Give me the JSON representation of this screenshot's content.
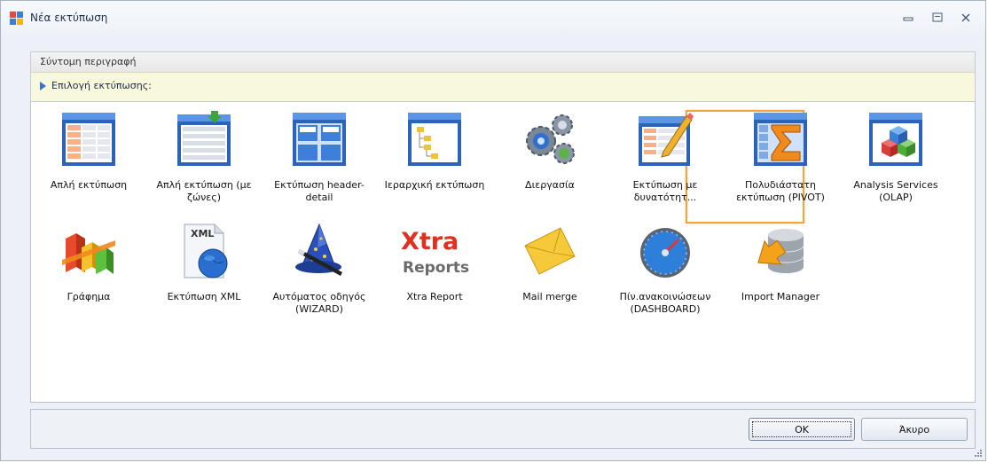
{
  "window": {
    "title": "Νέα εκτύπωση"
  },
  "description_panel": {
    "label": "Σύντομη περιγραφή"
  },
  "selection_panel": {
    "label": "Επιλογή εκτύπωσης:"
  },
  "items": [
    {
      "label": "Απλή εκτύπωση",
      "icon": "simple-report-icon"
    },
    {
      "label": "Απλή εκτύπωση (με ζώνες)",
      "icon": "banded-report-icon"
    },
    {
      "label": "Εκτύπωση header-detail",
      "icon": "header-detail-report-icon"
    },
    {
      "label": "Ιεραρχική εκτύπωση",
      "icon": "hierarchical-report-icon"
    },
    {
      "label": "Διεργασία",
      "icon": "gears-icon"
    },
    {
      "label": "Εκτύπωση με δυνατότητ...",
      "icon": "editable-report-icon"
    },
    {
      "label": "Πολυδιάστατη εκτύπωση (PIVOT)",
      "icon": "pivot-sigma-icon"
    },
    {
      "label": "Analysis Services (OLAP)",
      "icon": "olap-cubes-icon"
    },
    {
      "label": "Γράφημα",
      "icon": "bar-chart-icon"
    },
    {
      "label": "Εκτύπωση XML",
      "icon": "xml-globe-icon"
    },
    {
      "label": "Αυτόματος οδηγός (WIZARD)",
      "icon": "wizard-hat-icon"
    },
    {
      "label": "Xtra Report",
      "icon": "xtra-reports-logo"
    },
    {
      "label": "Mail merge",
      "icon": "envelope-icon"
    },
    {
      "label": "Πίν.ανακοινώσεων (DASHBOARD)",
      "icon": "dashboard-gauge-icon"
    },
    {
      "label": "Import Manager",
      "icon": "import-database-icon",
      "selected": true
    }
  ],
  "xtra_logo": {
    "line1": "Xtra",
    "line2": "Reports"
  },
  "xml_badge": "XML",
  "buttons": {
    "ok": "OK",
    "cancel": "Άκυρο"
  },
  "colors": {
    "accent_selection": "#f0a63c",
    "info_bar": "#f8f8dc",
    "title_text": "#1f2f4a"
  }
}
